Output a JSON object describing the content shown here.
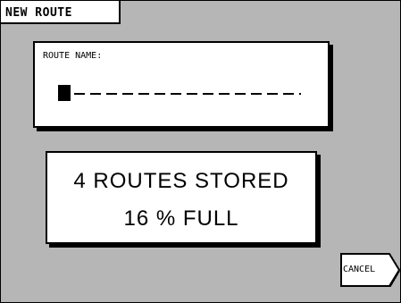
{
  "title": "NEW ROUTE",
  "route_name": {
    "label": "ROUTE NAME:",
    "value": ""
  },
  "status": {
    "routes_stored": "4 ROUTES STORED",
    "full": "16 % FULL"
  },
  "buttons": {
    "cancel": "CANCEL"
  },
  "colors": {
    "foreground": "#000000",
    "background": "#ffffff"
  }
}
